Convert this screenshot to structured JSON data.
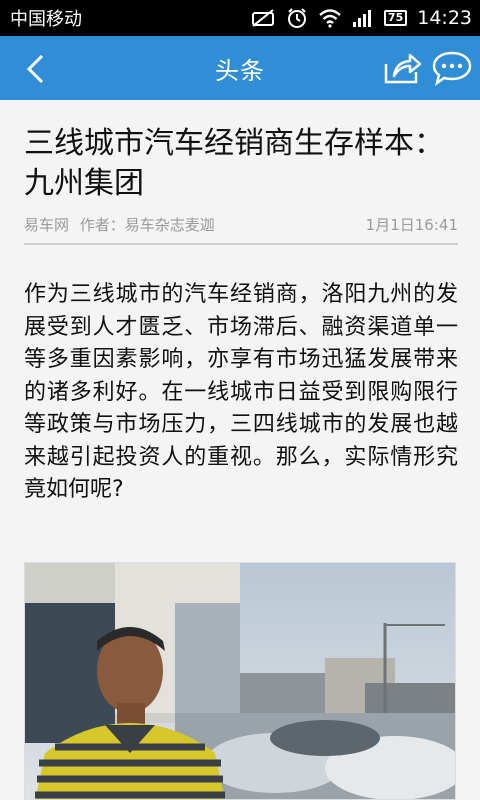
{
  "status_bar": {
    "carrier": "中国移动",
    "battery": "75",
    "time": "14:23",
    "icons": [
      "mute-icon",
      "alarm-icon",
      "wifi-icon",
      "signal-icon",
      "battery-icon"
    ]
  },
  "header": {
    "title": "头条",
    "back_icon": "chevron-left-icon",
    "share_icon": "share-icon",
    "comment_icon": "comment-icon",
    "bar_color": "#2f8ed6"
  },
  "article": {
    "headline": "三线城市汽车经销商生存样本：九州集团",
    "source": "易车网",
    "author": "作者：易车杂志麦迦",
    "date": "1月1日16:41",
    "body": "作为三线城市的汽车经销商，洛阳九州的发展受到人才匮乏、市场滞后、融资渠道单一等多重因素影响，亦享有市场迅猛发展带来的诸多利好。在一线城市日益受到限购限行等政策与市场压力，三四线城市的发展也越来越引起投资人的重视。那么，实际情形究竟如何呢?"
  }
}
